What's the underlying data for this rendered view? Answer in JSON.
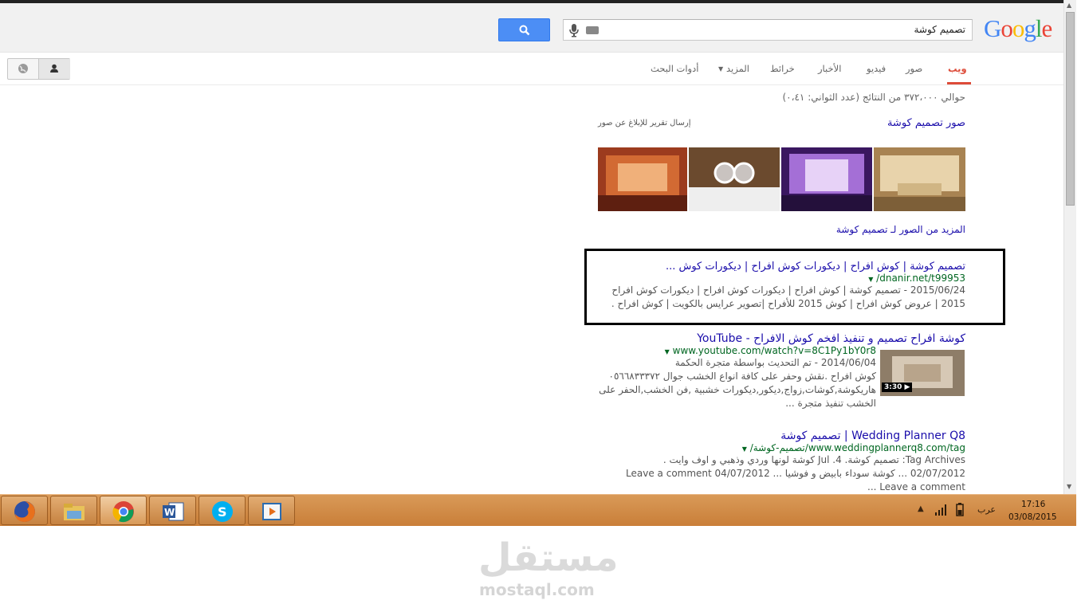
{
  "search": {
    "query": "تصميم كوشة",
    "logo": "Google"
  },
  "tabs": {
    "web": "ويب",
    "images": "صور",
    "videos": "فيديو",
    "news": "الأخبار",
    "maps": "خرائط",
    "more": "المزيد",
    "tools": "أدوات البحث"
  },
  "results_page": {
    "stats": "حوالي ٣٧٢،٠٠٠ من النتائج (عدد الثواني: ٠،٤١)",
    "images_title": "صور تصميم كوشة",
    "images_report": "إرسال تقرير للإبلاغ عن صور",
    "more_images": "المزيد من الصور لـ تصميم كوشة"
  },
  "results": [
    {
      "title": "تصميم كوشة | كوش افراح | ديكورات كوش افراح | ديكورات كوش ...",
      "url": "dnanir.net/t99953/",
      "snippet_line1": "2015/06/24 - تصميم كوشة | كوش افراح | ديكورات كوش افراح | ديكورات كوش افراح",
      "snippet_line2": "2015 | عروض كوش افراح | كوش 2015 للأفراح |تصوير عرايس بالكويت | كوش افراح ."
    },
    {
      "title": "كوشة افراح تصميم و تنفيذ افخم كوش الافراح - YouTube",
      "url": "www.youtube.com/watch?v=8C1Py1bY0r8",
      "snippet_line1": "2014/06/04 - تم التحديث بواسطة متجرة الحكمة",
      "snippet_line2": "كوش افراح .نقش وحفر على كافة انواع الخشب جوال ٠٥٦٦٨٣٣٣٧٢",
      "snippet_line3": "هاريكوشة,كوشات,زواج,ديكور,ديكورات خشبية ,فن الخشب,الحفر على",
      "snippet_line4": "الخشب تنفيذ متجرة ...",
      "duration": "3:30"
    },
    {
      "title": "Wedding Planner Q8 | تصميم كوشة",
      "url": "www.weddingplannerq8.com/tag/تصميم-كوشة/",
      "snippet_line1": "Tag Archives: تصميم كوشة. Jul .4 كوشة لونها وردي وذهبي و اوف وايت .",
      "snippet_line2": "02/07/2012 ... كوشة سوداء بابيض و فوشيا ... Leave a comment 04/07/2012",
      "snippet_line3": "Leave a comment ..."
    }
  ],
  "taskbar": {
    "apps": [
      "firefox-icon",
      "file-explorer-icon",
      "chrome-icon",
      "word-icon",
      "skype-icon",
      "media-player-icon"
    ],
    "lang": "عرب",
    "time": "17:16",
    "date": "03/08/2015"
  },
  "watermark": {
    "arabic": "مستقل",
    "latin": "mostaql.com"
  },
  "colors": {
    "link": "#1a0dab",
    "url": "#006621",
    "accent_tab": "#dd4b39",
    "search_button": "#4c8ef5",
    "taskbar": "#d38e4d"
  }
}
